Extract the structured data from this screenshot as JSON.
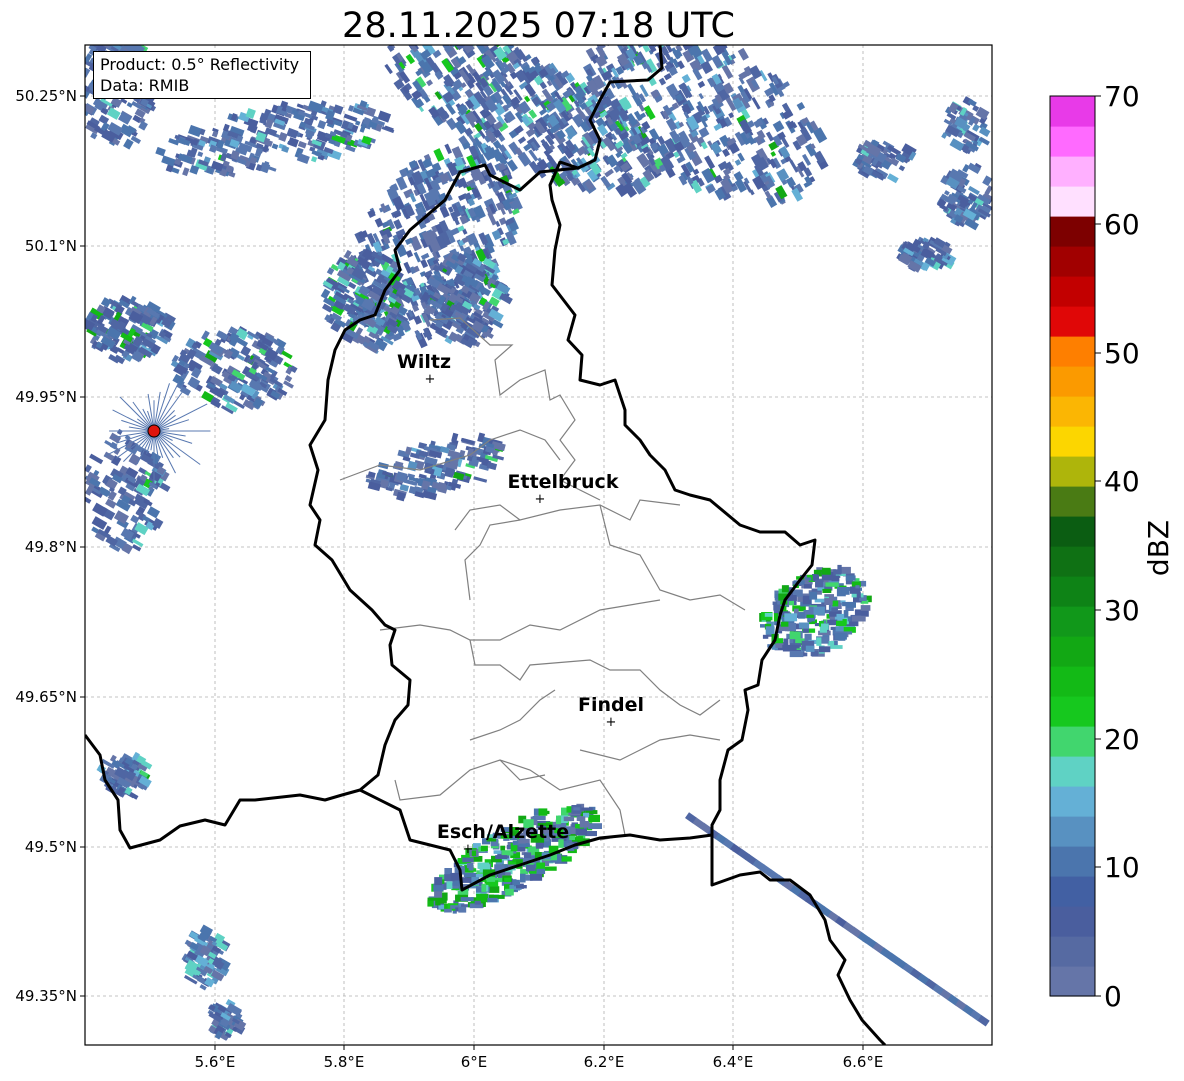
{
  "title": "28.11.2025 07:18 UTC",
  "info": {
    "product": "Product: 0.5° Reflectivity",
    "data": "Data: RMIB"
  },
  "lat_labels": [
    "50.25°N",
    "50.1°N",
    "49.95°N",
    "49.8°N",
    "49.65°N",
    "49.5°N",
    "49.35°N"
  ],
  "lon_labels": [
    "5.6°E",
    "5.8°E",
    "6°E",
    "6.2°E",
    "6.4°E",
    "6.6°E"
  ],
  "cities": [
    {
      "name": "Wiltz"
    },
    {
      "name": "Ettelbruck"
    },
    {
      "name": "Findel"
    },
    {
      "name": "Esch/Alzette"
    }
  ],
  "radar_marker": {
    "color": "#e0140c"
  },
  "colorbar": {
    "label": "dBZ",
    "ticks": [
      "0",
      "10",
      "20",
      "30",
      "40",
      "50",
      "60",
      "70"
    ],
    "colors": [
      "#6575a8",
      "#566aa2",
      "#4a5e9e",
      "#4260a3",
      "#4b75ad",
      "#5891c1",
      "#64b0d6",
      "#5fd2c4",
      "#41d66e",
      "#16c81e",
      "#13ba16",
      "#12a814",
      "#11981a",
      "#0e8316",
      "#0f7114",
      "#0b5d12",
      "#4a7b14",
      "#aeb50b",
      "#fcd600",
      "#fbb603",
      "#fb9a00",
      "#fe7f00",
      "#e00707",
      "#c20000",
      "#a10000",
      "#7d0000",
      "#ffe0ff",
      "#ffb0ff",
      "#ff6aff",
      "#e83ae8"
    ]
  }
}
